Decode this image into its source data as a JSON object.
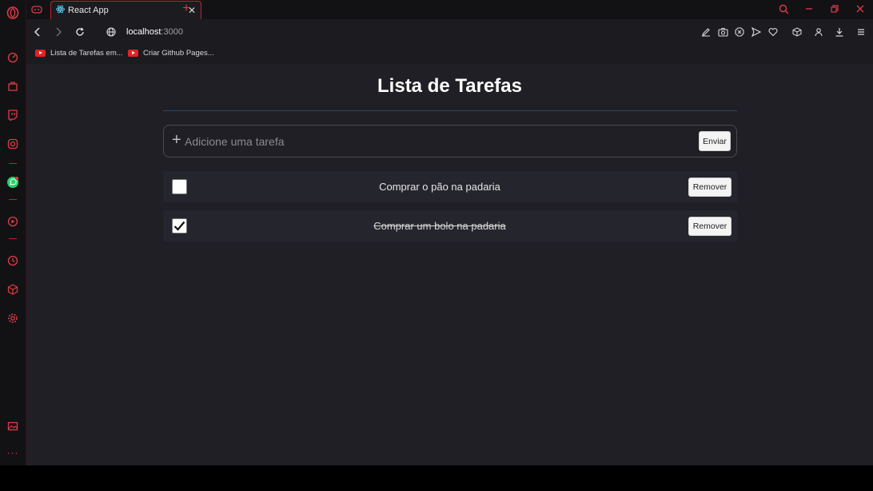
{
  "browser": {
    "tab_title": "React App",
    "url_host": "localhost",
    "url_port": ":3000",
    "accent_color": "#c4202c",
    "bookmarks": [
      {
        "label": "Lista de Tarefas em...",
        "icon": "youtube-icon"
      },
      {
        "label": "Criar Github Pages...",
        "icon": "youtube-icon"
      }
    ]
  },
  "app": {
    "title": "Lista de Tarefas",
    "input": {
      "placeholder": "Adicione uma tarefa",
      "value": ""
    },
    "send_label": "Enviar",
    "tasks": [
      {
        "text": "Comprar o pão na padaria",
        "done": false,
        "remove_label": "Remover"
      },
      {
        "text": "Comprar um bolo na padaria",
        "done": true,
        "remove_label": "Remover"
      }
    ]
  }
}
